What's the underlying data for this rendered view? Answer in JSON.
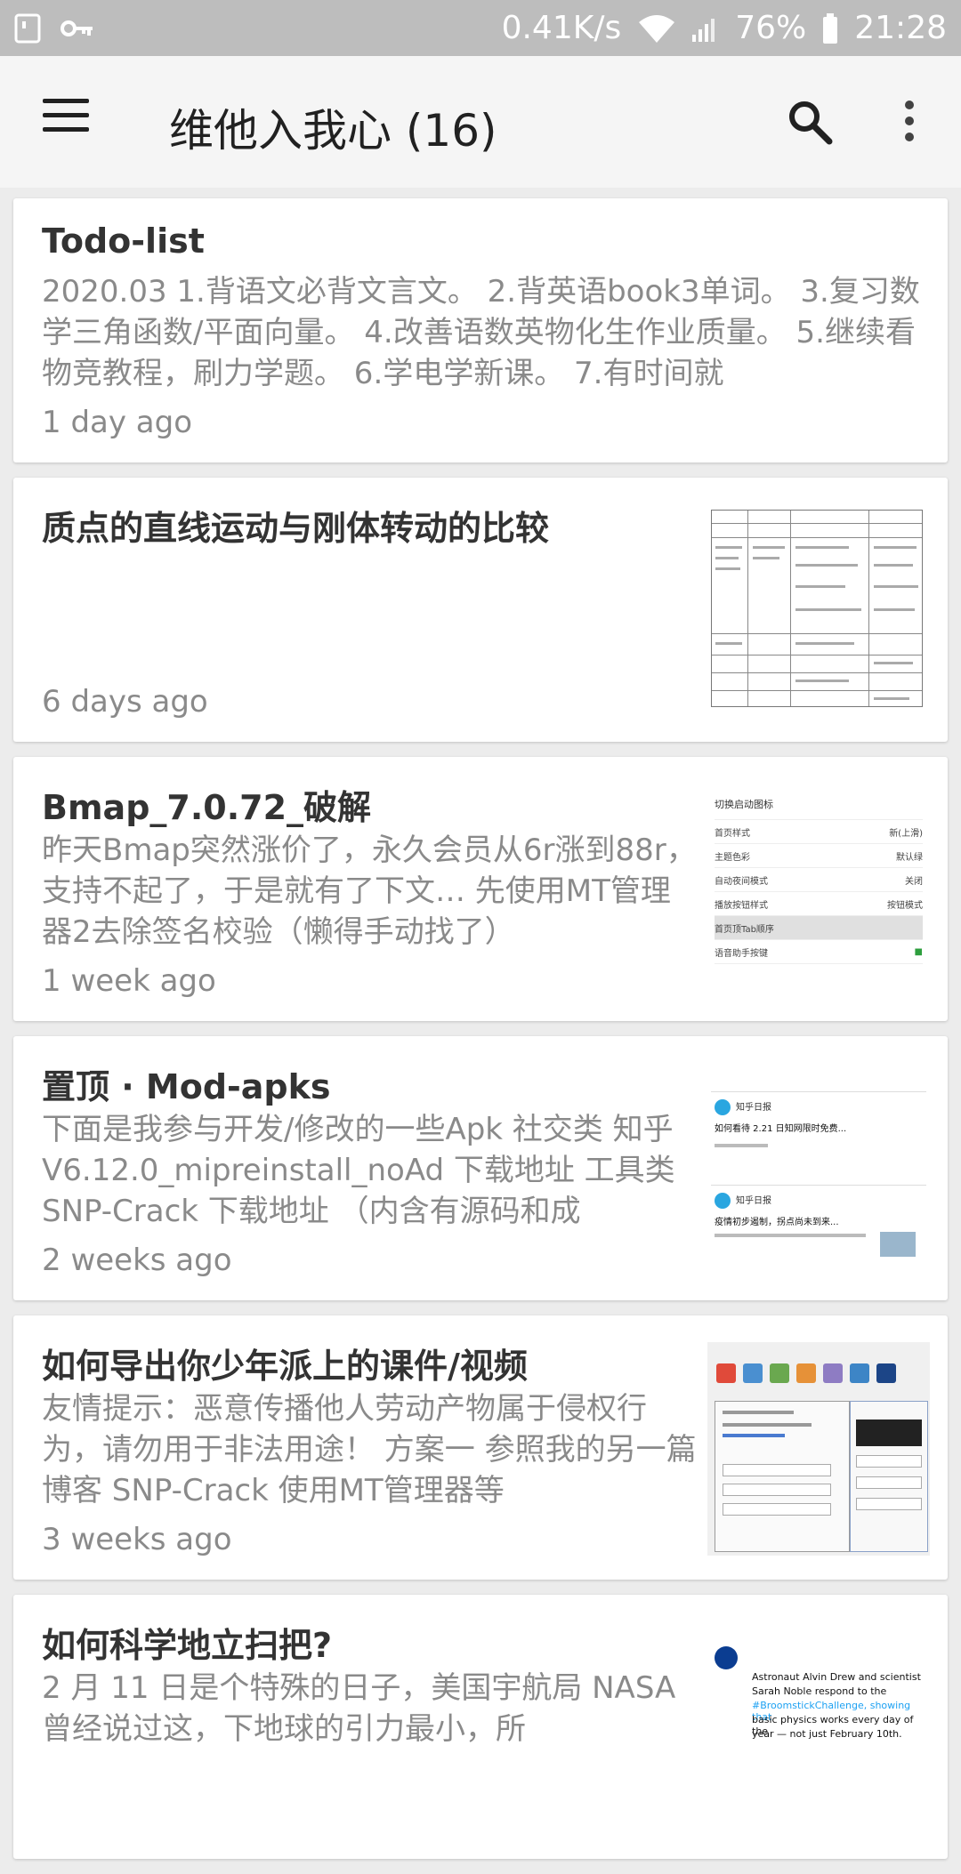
{
  "status_bar": {
    "network_speed": "0.41K/s",
    "battery": "76%",
    "time": "21:28",
    "icons": [
      "sim-card-icon",
      "vpn-key-icon",
      "wifi-icon",
      "signal-icon",
      "battery-icon"
    ]
  },
  "app_bar": {
    "title": "维他入我心 (16)",
    "menu_icon": "hamburger-menu-icon",
    "search_icon": "search-icon",
    "more_icon": "more-vert-icon"
  },
  "posts": [
    {
      "title": "Todo-list",
      "excerpt": "2020.03 1.背语文必背文言文。 2.背英语book3单词。 3.复习数学三角函数/平面向量。 4.改善语数英物化生作业质量。 5.继续看物竞教程，刷力学题。 6.学电学新课。 7.有时间就",
      "time": "1 day ago",
      "has_thumbnail": false
    },
    {
      "title": "质点的直线运动与刚体转动的比较",
      "excerpt": "",
      "time": "6 days ago",
      "has_thumbnail": true,
      "thumbnail": "physics-comparison-table"
    },
    {
      "title": "Bmap_7.0.72_破解",
      "excerpt": "昨天Bmap突然涨价了，永久会员从6r涨到88r，支持不起了，于是就有了下文… 先使用MT管理器2去除签名校验（懒得手动找了）",
      "time": "1 week ago",
      "has_thumbnail": true,
      "thumbnail": "settings-screenshot",
      "thumb_text": {
        "header": "切换启动图标",
        "rows": [
          "首页样式",
          "主题色彩",
          "自动夜间模式",
          "播放按钮样式",
          "首页顶Tab顺序",
          "语音助手按键"
        ],
        "values": [
          "新(上滑)",
          "默认绿",
          "关闭",
          "按钮模式",
          "",
          ""
        ]
      }
    },
    {
      "title": "置顶 · Mod-apks",
      "excerpt": "下面是我参与开发/修改的一些Apk 社交类 知乎V6.12.0_mipreinstall_noAd 下载地址 工具类 SNP-Crack 下载地址 （内含有源码和成",
      "time": "2 weeks ago",
      "has_thumbnail": true,
      "thumbnail": "zhihu-feed-screenshot",
      "thumb_text": {
        "author": "知乎日报",
        "post1": "如何看待 2.21 日知网限时免费...",
        "post2": "疫情初步遏制，拐点尚未到来..."
      }
    },
    {
      "title": "如何导出你少年派上的课件/视频",
      "excerpt": "友情提示：恶意传播他人劳动产物属于侵权行为，请勿用于非法用途！ 方案一 参照我的另一篇博客 SNP-Crack 使用MT管理器等",
      "time": "3 weeks ago",
      "has_thumbnail": true,
      "thumbnail": "keygen-app-screenshot"
    },
    {
      "title": "如何科学地立扫把?",
      "excerpt": "2 月 11 日是个特殊的日子，美国宇航局 NASA 曾经说过这，下地球的引力最小，所",
      "time": "",
      "has_thumbnail": true,
      "thumbnail": "nasa-tweet-screenshot",
      "thumb_text": {
        "line1": "Astronaut Alvin Drew and scientist",
        "line2": "Sarah Noble respond to the",
        "line3": "#BroomstickChallenge, showing that",
        "line4": "basic physics works every day of the",
        "line5": "year — not just February 10th."
      }
    }
  ],
  "colors": {
    "status_bar_bg": "#bdbdbd",
    "app_bar_bg": "#f5f5f5",
    "list_bg": "#ececec",
    "card_bg": "#ffffff",
    "title_text": "#333333",
    "secondary_text": "#8a8a8a"
  }
}
